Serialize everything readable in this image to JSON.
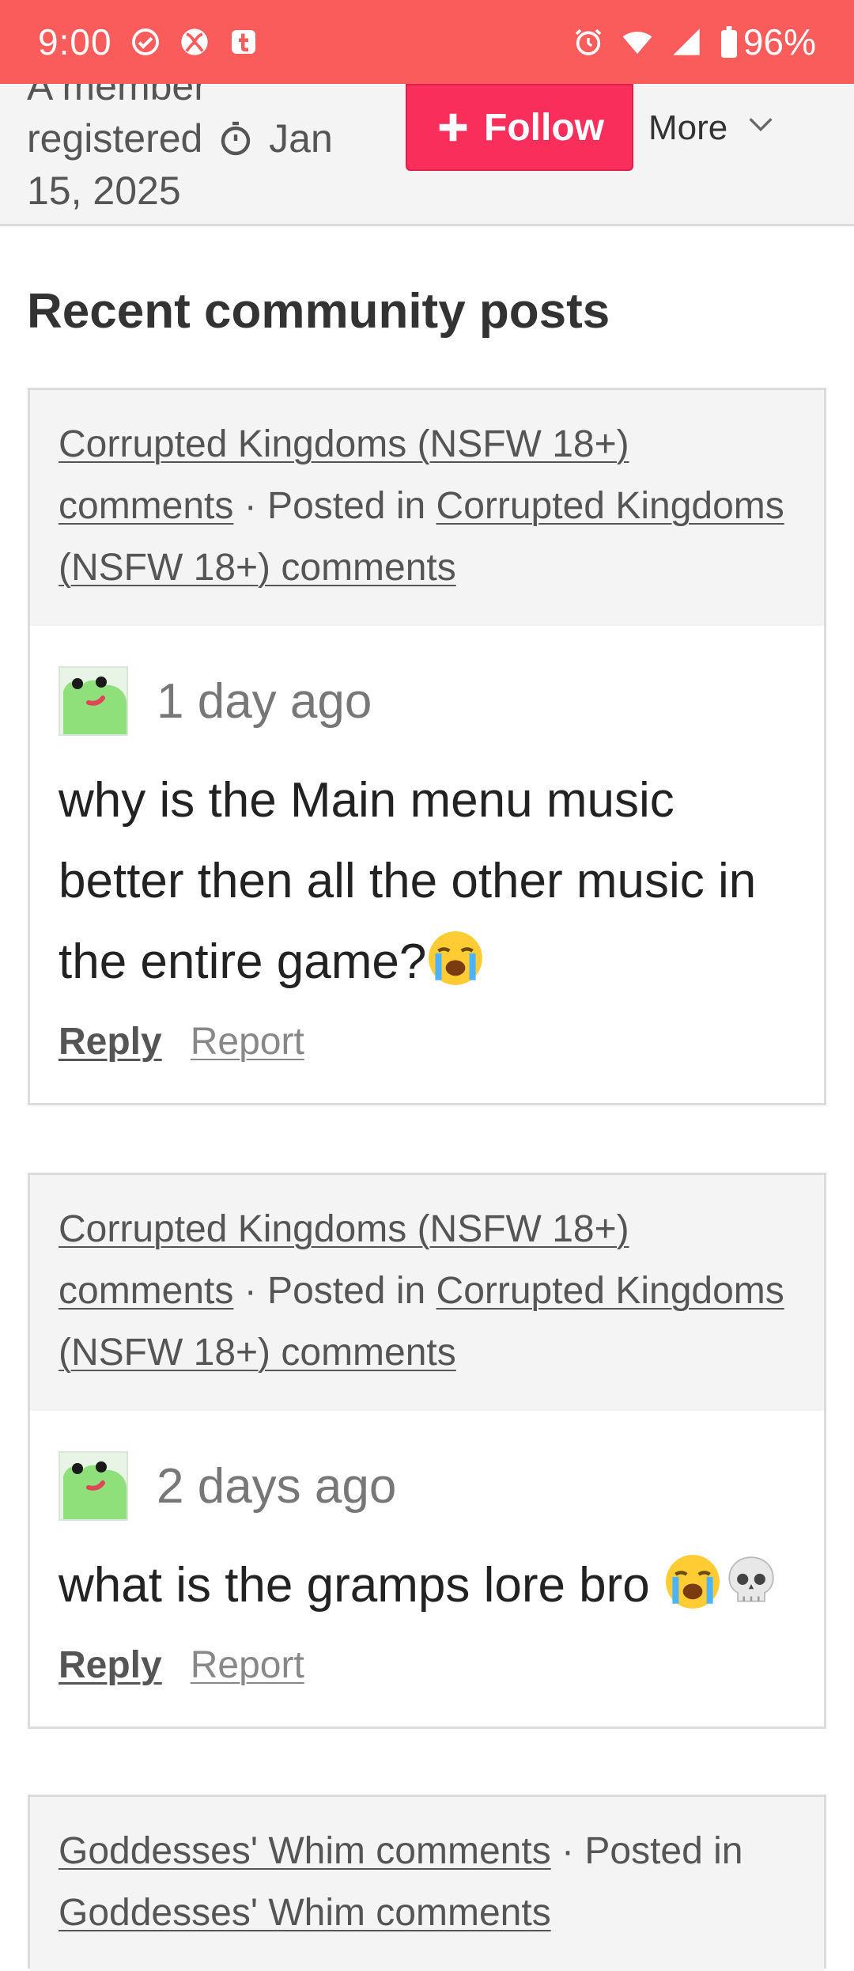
{
  "status_bar": {
    "time": "9:00",
    "battery": "96%",
    "left_icons": [
      "check-circle-icon",
      "xbox-icon",
      "tumblr-icon"
    ],
    "right_icons": [
      "alarm-icon",
      "wifi-icon",
      "signal-icon",
      "battery-icon"
    ]
  },
  "profile": {
    "member_text_line0": "A member",
    "member_text_before": "registered",
    "member_date": "Jan 15, 2025",
    "follow_label": "Follow",
    "more_label": "More"
  },
  "section": {
    "title": "Recent community posts"
  },
  "posts": [
    {
      "game_link": "Corrupted Kingdoms (NSFW 18+) comments",
      "posted_in_label": "· Posted in",
      "forum_link": "Corrupted Kingdoms (NSFW 18+) comments",
      "time": "1 day ago",
      "text": "why is the Main menu  music better then all the other music in the entire game?",
      "emojis": [
        "loudly-crying-face"
      ],
      "reply_label": "Reply",
      "report_label": "Report"
    },
    {
      "game_link": "Corrupted Kingdoms (NSFW 18+) comments",
      "posted_in_label": "· Posted in",
      "forum_link": "Corrupted Kingdoms (NSFW 18+) comments",
      "time": "2 days ago",
      "text": "what is the gramps lore bro ",
      "emojis": [
        "loudly-crying-face",
        "skull"
      ],
      "reply_label": "Reply",
      "report_label": "Report"
    },
    {
      "game_link": "Goddesses' Whim comments",
      "posted_in_label": "· Posted in",
      "forum_link": "Goddesses' Whim comments"
    }
  ],
  "colors": {
    "status_bar": "#fa5c5c",
    "follow_button": "#fa2e5b",
    "header_bg": "#f4f4f4",
    "card_border": "#dcdcdc"
  }
}
